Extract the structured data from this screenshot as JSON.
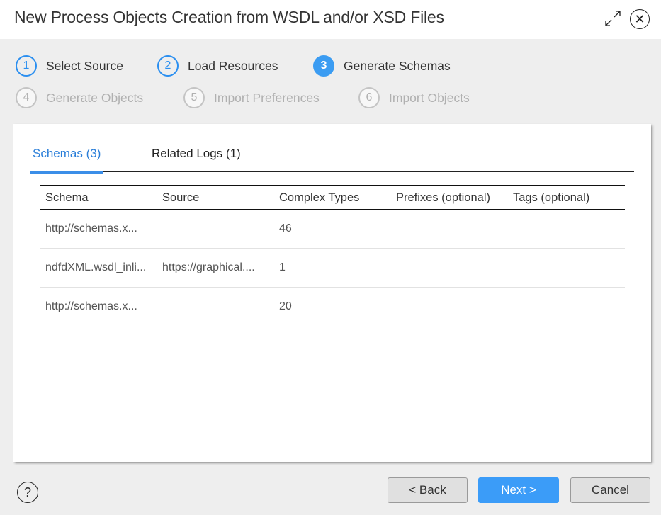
{
  "dialog": {
    "title": "New Process Objects Creation from WSDL and/or XSD Files",
    "expand_icon": "expand-arrows-icon",
    "close_icon": "close-circle-icon",
    "close_glyph": "✕"
  },
  "steps": [
    {
      "number": "1",
      "label": "Select Source",
      "state": "completed"
    },
    {
      "number": "2",
      "label": "Load Resources",
      "state": "completed"
    },
    {
      "number": "3",
      "label": "Generate Schemas",
      "state": "current"
    },
    {
      "number": "4",
      "label": "Generate Objects",
      "state": "disabled"
    },
    {
      "number": "5",
      "label": "Import Preferences",
      "state": "disabled"
    },
    {
      "number": "6",
      "label": "Import Objects",
      "state": "disabled"
    }
  ],
  "tabs": [
    {
      "label": "Schemas (3)",
      "active": true
    },
    {
      "label": "Related Logs (1)",
      "active": false
    }
  ],
  "table": {
    "columns": [
      "Schema",
      "Source",
      "Complex Types",
      "Prefixes (optional)",
      "Tags (optional)"
    ],
    "rows": [
      [
        "http://schemas.x...",
        "",
        "46",
        "",
        ""
      ],
      [
        "ndfdXML.wsdl_inli...",
        "https://graphical....",
        "1",
        "",
        ""
      ],
      [
        "http://schemas.x...",
        "",
        "20",
        "",
        ""
      ]
    ]
  },
  "footer": {
    "help_glyph": "?",
    "back_label": "< Back",
    "next_label": "Next >",
    "cancel_label": "Cancel"
  },
  "colors": {
    "accent": "#3b9cf2",
    "tab_active": "#2b7fd9",
    "disabled_text": "#b0b0b0"
  }
}
